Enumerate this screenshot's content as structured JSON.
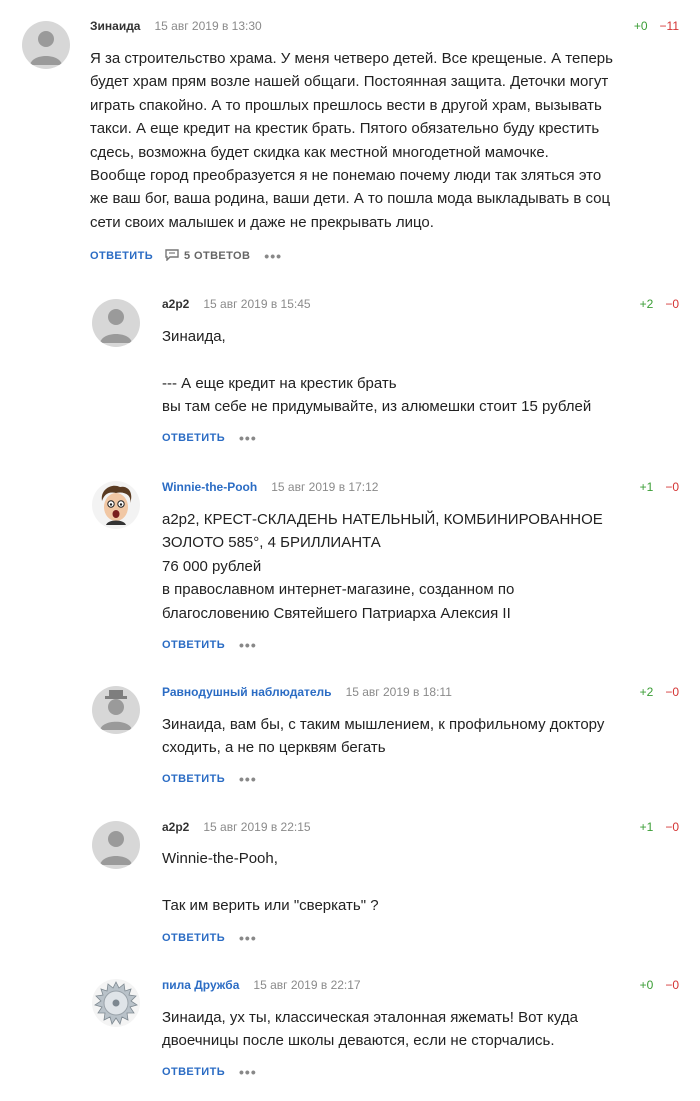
{
  "comments": [
    {
      "author": "Зинаида",
      "date": "15 авг 2019 в 13:30",
      "plus": "+0",
      "minus": "−11",
      "lines": [
        "Я за строительство храма. У меня четверо детей. Все крещеные. А теперь",
        "будет храм прям возле нашей общаги. Постоянная защита. Деточки могут",
        "играть спакойно. А то прошлых прешлось вести в другой храм, вызывать",
        "такси. А еще кредит на крестик брать. Пятого обязательно буду крестить",
        "сдесь, возможна будет скидка как местной многодетной мамочке.",
        "Вообще город преобразуется я не понемаю почему люди так зляться это",
        "же ваш бог, ваша родина, ваши дети. А то пошла мода выкладывать в соц",
        "сети своих малышек и даже не прекрывать лицо."
      ],
      "reply": "Ответить",
      "answers": "5 ответов",
      "avatar_icon": "default-avatar"
    },
    {
      "author": "a2p2",
      "date": "15 авг 2019 в 15:45",
      "plus": "+2",
      "minus": "−0",
      "lines": [
        "Зинаида,",
        "",
        "--- А еще кредит на крестик брать",
        "вы там себе не придумывайте, из алюмешки стоит 15 рублей"
      ],
      "reply": "Ответить",
      "avatar_icon": "default-avatar"
    },
    {
      "author": "Winnie-the-Pooh",
      "date": "15 авг 2019 в 17:12",
      "plus": "+1",
      "minus": "−0",
      "lines": [
        "a2p2, КРЕСТ-СКЛАДЕНЬ НАТЕЛЬНЫЙ, КОМБИНИРОВАННОЕ",
        "ЗОЛОТО 585°, 4 БРИЛЛИАНТА",
        "76 000 рублей",
        "в православном интернет-магазине, созданном по",
        "благословению Святейшего Патриарха Алексия II"
      ],
      "reply": "Ответить",
      "avatar_icon": "cartoon-face-avatar"
    },
    {
      "author": "Равнодушный наблюдатель",
      "date": "15 авг 2019 в 18:11",
      "plus": "+2",
      "minus": "−0",
      "lines": [
        "Зинаида, вам бы, с таким мышлением, к профильному доктору",
        "сходить, а не по церквям бегать"
      ],
      "reply": "Ответить",
      "avatar_icon": "hat-avatar"
    },
    {
      "author": "a2p2",
      "date": "15 авг 2019 в 22:15",
      "plus": "+1",
      "minus": "−0",
      "lines": [
        "Winnie-the-Pooh,",
        "",
        "Так им верить или \"сверкать\" ?"
      ],
      "reply": "Ответить",
      "avatar_icon": "default-avatar"
    },
    {
      "author": "пила Дружба",
      "date": "15 авг 2019 в 22:17",
      "plus": "+0",
      "minus": "−0",
      "lines": [
        "Зинаида, ух ты, классическая эталонная яжемать! Вот куда",
        "двоечницы после школы деваются, если не сторчались."
      ],
      "reply": "Ответить",
      "avatar_icon": "saw-blade-avatar"
    }
  ],
  "colors": {
    "plus": "#3a9d35",
    "minus": "#d43434",
    "link": "#2b6cc4"
  }
}
